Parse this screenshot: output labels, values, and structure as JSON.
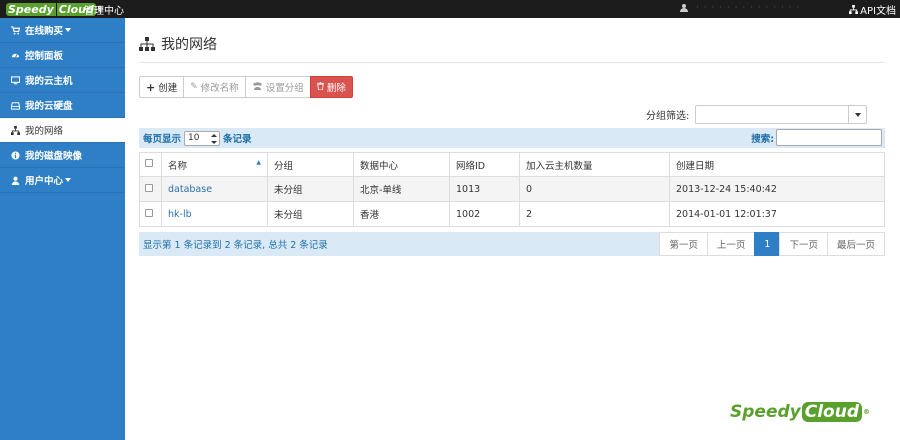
{
  "topbar": {
    "logo_part1": "Speedy",
    "logo_part2": "Cloud",
    "logo_reg": "®",
    "app_title": "管理中心",
    "username": "· · · · · · · · · · · · · ·",
    "api_doc": "API文档"
  },
  "sidebar": {
    "items": [
      {
        "label": "在线购买",
        "icon": "cart-icon",
        "has_caret": true
      },
      {
        "label": "控制面板",
        "icon": "dashboard-icon"
      },
      {
        "label": "我的云主机",
        "icon": "monitor-icon"
      },
      {
        "label": "我的云硬盘",
        "icon": "hdd-icon"
      },
      {
        "label": "我的网络",
        "icon": "sitemap-icon",
        "active": true
      },
      {
        "label": "我的磁盘映像",
        "icon": "info-icon"
      },
      {
        "label": "用户中心",
        "icon": "user-icon",
        "has_caret": true
      }
    ]
  },
  "page": {
    "title": "我的网络"
  },
  "toolbar": {
    "create_label": "创建",
    "rename_label": "修改名称",
    "group_label": "设置分组",
    "delete_label": "删除"
  },
  "filter": {
    "label": "分组筛选:",
    "value": ""
  },
  "datatable": {
    "length_prefix": "每页显示",
    "length_value": "10",
    "length_suffix": "条记录",
    "search_label": "搜索:",
    "search_value": "",
    "columns": [
      "名称",
      "分组",
      "数据中心",
      "网络ID",
      "加入云主机数量",
      "创建日期"
    ],
    "rows": [
      {
        "name": "database",
        "group": "未分组",
        "datacenter": "北京-单线",
        "network_id": "1013",
        "vm_count": "0",
        "created": "2013-12-24 15:40:42"
      },
      {
        "name": "hk-lb",
        "group": "未分组",
        "datacenter": "香港",
        "network_id": "1002",
        "vm_count": "2",
        "created": "2014-01-01 12:01:37"
      }
    ],
    "info": "显示第 1 条记录到 2 条记录, 总共 2 条记录",
    "pager": {
      "first": "第一页",
      "prev": "上一页",
      "current": "1",
      "next": "下一页",
      "last": "最后一页"
    }
  },
  "footer": {
    "logo_part1": "Speedy",
    "logo_part2": "Cloud",
    "logo_reg": "®"
  },
  "colors": {
    "sidebar": "#2f7fc6",
    "topbar": "#1c1c1c",
    "danger": "#d9534f",
    "brand_green": "#5aa02c",
    "table_header_bar": "#d9eaf6"
  }
}
